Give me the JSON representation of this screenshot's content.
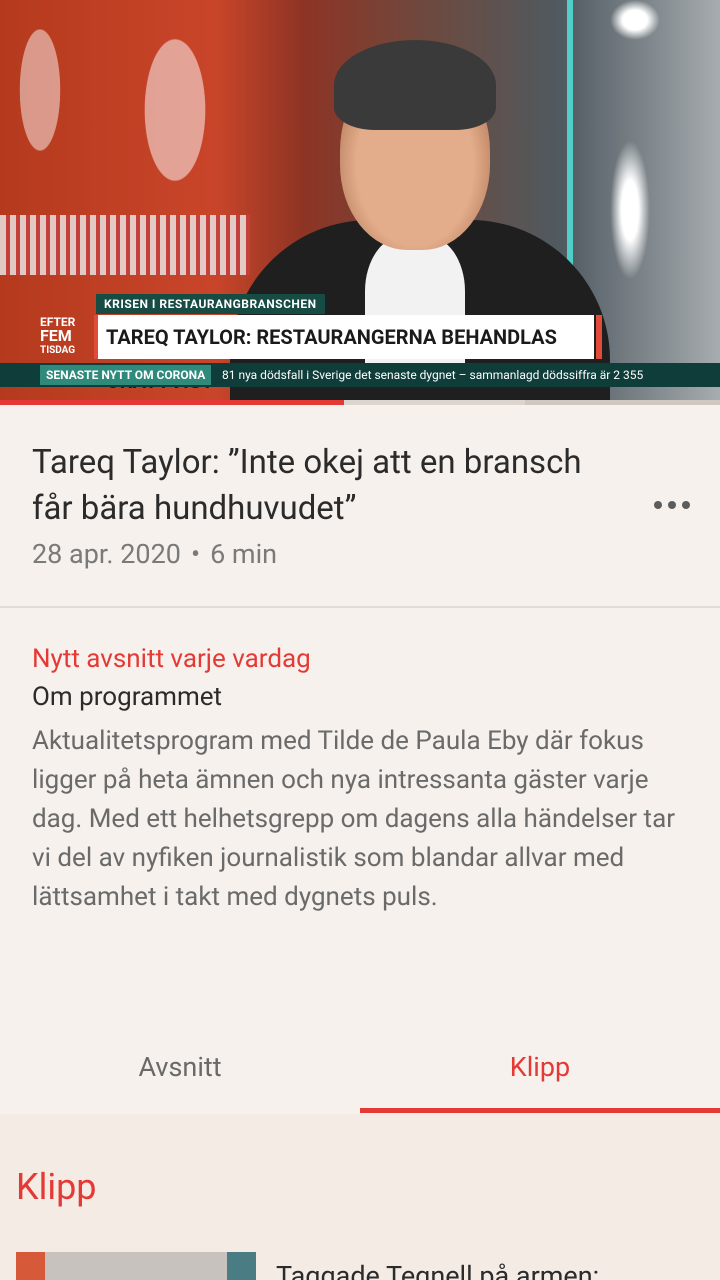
{
  "video": {
    "kicker": "KRISEN I RESTAURANGBRANSCHEN",
    "headline": "TAREQ TAYLOR: RESTAURANGERNA BEHANDLAS ORÄTTVIST",
    "logo": {
      "line1": "EFTER",
      "line2": "FEM",
      "line3": "TISDAG"
    },
    "ticker_label": "SENASTE NYTT OM CORONA",
    "ticker_text": "81 nya dödsfall i Sverige det senaste dygnet – sammanlagd dödssiffra är 2 355"
  },
  "progress": {
    "played_fraction": 0.478,
    "buffered_fraction": 0.729
  },
  "episode": {
    "title": "Tareq Taylor: ”Inte okej att en bransch får bära hundhuvudet”",
    "date": "28 apr. 2020",
    "duration": "6 min",
    "more_icon": "more-horizontal-icon"
  },
  "program": {
    "schedule": "Nytt avsnitt varje vardag",
    "about_title": "Om programmet",
    "description": "Aktualitetsprogram med Tilde de Paula Eby där fokus ligger på heta ämnen och nya intressanta gäster varje dag. Med ett helhetsgrepp om dagens alla händelser tar vi del av nyfiken journalistik som blandar allvar med lättsamhet i takt med dygnets puls."
  },
  "tabs": [
    {
      "label": "Avsnitt",
      "active": false
    },
    {
      "label": "Klipp",
      "active": true
    }
  ],
  "clips": {
    "section_title": "Klipp",
    "items": [
      {
        "title": "Taggade Tegnell på armen:"
      }
    ]
  },
  "colors": {
    "accent": "#e53935",
    "background": "#f6f1ec",
    "section_background": "#f3ebe4"
  }
}
